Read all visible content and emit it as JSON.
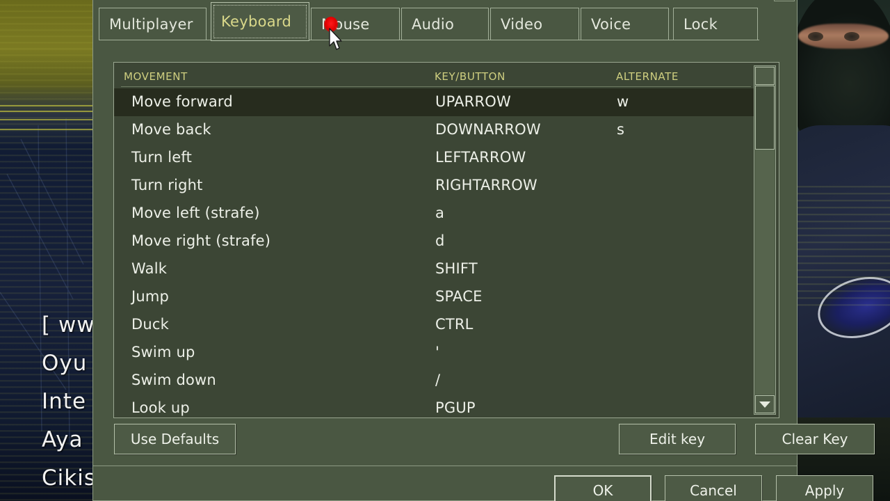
{
  "window": {
    "title": "",
    "tabs": [
      {
        "label": "Multiplayer",
        "active": false
      },
      {
        "label": "Keyboard",
        "active": true
      },
      {
        "label": "Mouse",
        "active": false
      },
      {
        "label": "Audio",
        "active": false
      },
      {
        "label": "Video",
        "active": false
      },
      {
        "label": "Voice",
        "active": false
      },
      {
        "label": "Lock",
        "active": false
      }
    ]
  },
  "keyboard_panel": {
    "columns": [
      "MOVEMENT",
      "KEY/BUTTON",
      "ALTERNATE"
    ],
    "rows": [
      {
        "action": "Move forward",
        "key": "UPARROW",
        "alt": "w",
        "selected": true
      },
      {
        "action": "Move back",
        "key": "DOWNARROW",
        "alt": "s",
        "selected": false
      },
      {
        "action": "Turn left",
        "key": "LEFTARROW",
        "alt": "",
        "selected": false
      },
      {
        "action": "Turn right",
        "key": "RIGHTARROW",
        "alt": "",
        "selected": false
      },
      {
        "action": "Move left (strafe)",
        "key": "a",
        "alt": "",
        "selected": false
      },
      {
        "action": "Move right (strafe)",
        "key": "d",
        "alt": "",
        "selected": false
      },
      {
        "action": "Walk",
        "key": "SHIFT",
        "alt": "",
        "selected": false
      },
      {
        "action": "Jump",
        "key": "SPACE",
        "alt": "",
        "selected": false
      },
      {
        "action": "Duck",
        "key": "CTRL",
        "alt": "",
        "selected": false
      },
      {
        "action": "Swim up",
        "key": "'",
        "alt": "",
        "selected": false
      },
      {
        "action": "Swim down",
        "key": "/",
        "alt": "",
        "selected": false
      },
      {
        "action": "Look up",
        "key": "PGUP",
        "alt": "",
        "selected": false
      }
    ]
  },
  "buttons": {
    "use_defaults": "Use Defaults",
    "edit_key": "Edit key",
    "clear_key": "Clear Key",
    "ok": "OK",
    "cancel": "Cancel",
    "apply": "Apply"
  },
  "background_menu": {
    "items": [
      "[ ww",
      "Oyu",
      "Inte",
      "Aya",
      "Cikis"
    ]
  },
  "colors": {
    "dialog_bg": "#4a5742",
    "list_bg": "#3c4635",
    "row_selected_bg": "#272c1e",
    "header_text": "#cfcf80",
    "active_tab_text": "#d9d88a",
    "body_text": "#edf0e8",
    "border": "#a3b099",
    "click_marker": "#e00000"
  },
  "icons": {
    "scroll_up": "scroll-up-arrow-icon",
    "scroll_down": "scroll-down-arrow-icon",
    "cursor": "mouse-cursor-icon",
    "click_marker": "click-marker-icon"
  }
}
